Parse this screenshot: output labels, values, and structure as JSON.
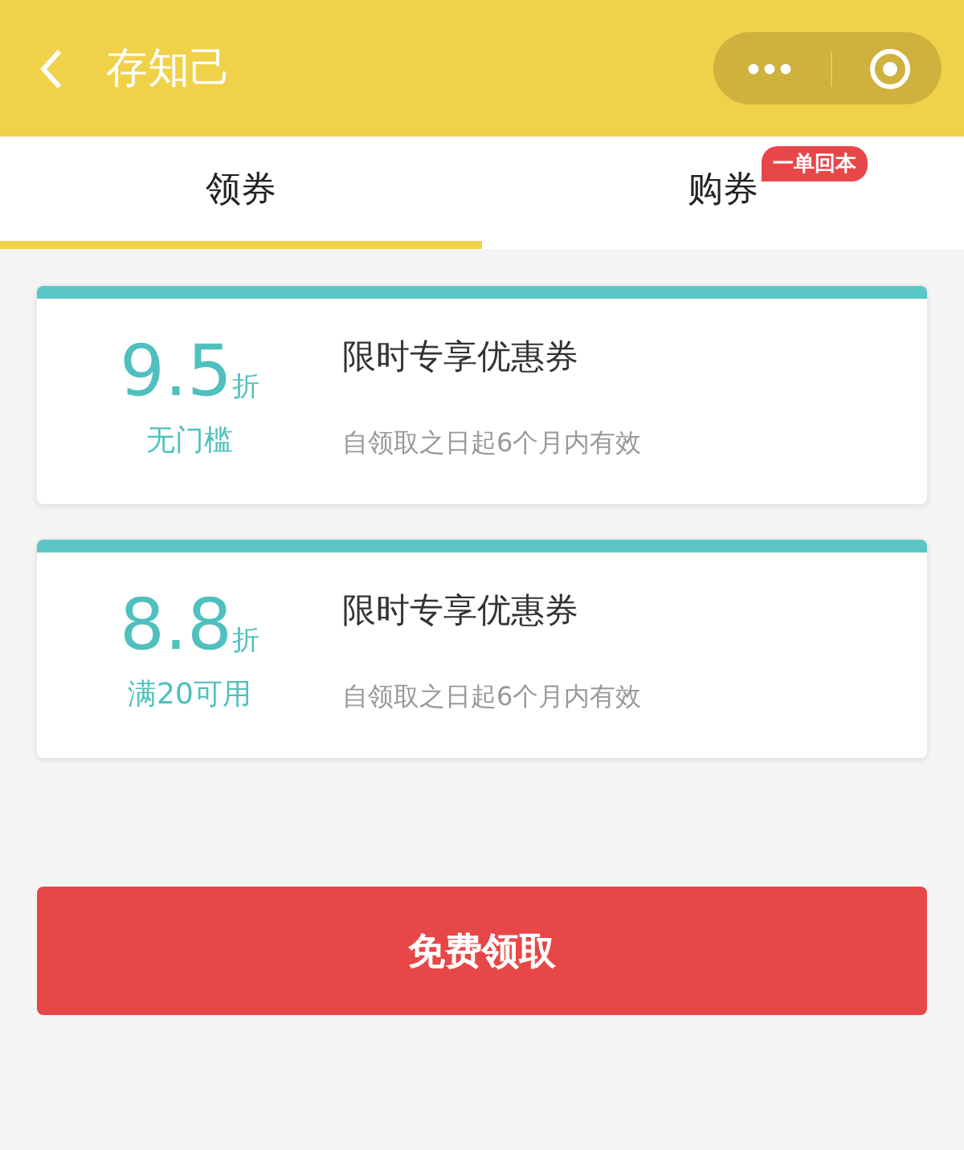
{
  "header": {
    "title": "存知己"
  },
  "tabs": [
    {
      "label": "领券",
      "selected": true
    },
    {
      "label": "购券",
      "selected": false,
      "badge": "一单回本"
    }
  ],
  "coupons": [
    {
      "value": "9.5",
      "unit": "折",
      "condition": "无门槛",
      "title": "限时专享优惠券",
      "validity": "自领取之日起6个月内有效"
    },
    {
      "value": "8.8",
      "unit": "折",
      "condition": "满20可用",
      "title": "限时专享优惠券",
      "validity": "自领取之日起6个月内有效"
    }
  ],
  "button": {
    "label": "免费领取"
  }
}
